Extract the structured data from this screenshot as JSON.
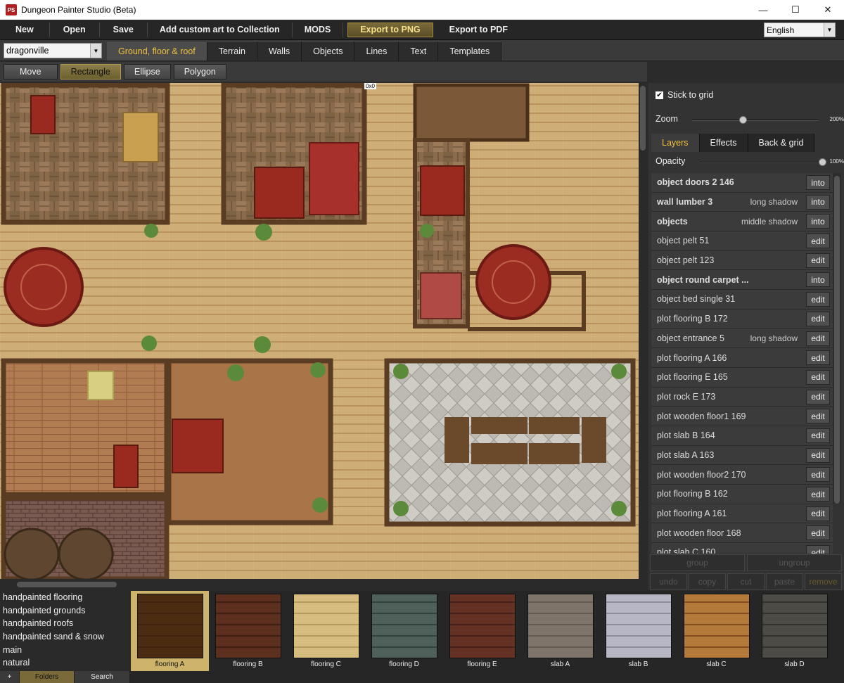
{
  "window": {
    "title": "Dungeon Painter Studio (Beta)",
    "logo_text": "PS",
    "minimize": "—",
    "maximize": "☐",
    "close": "✕"
  },
  "menu": {
    "items": [
      "New",
      "Open",
      "Save",
      "Add custom art to Collection",
      "MODS",
      "Export to PNG",
      "Export to PDF"
    ],
    "language": "English"
  },
  "map_selector": {
    "value": "dragonville"
  },
  "category_tabs": [
    "Ground, floor & roof",
    "Terrain",
    "Walls",
    "Objects",
    "Lines",
    "Text",
    "Templates"
  ],
  "shape_tools": [
    "Move",
    "Rectangle",
    "Ellipse",
    "Polygon"
  ],
  "canvas": {
    "size_readout": "0x0"
  },
  "right_panel": {
    "stick_to_grid": "Stick to grid",
    "zoom_label": "Zoom",
    "zoom_value": "200%",
    "zoom_level": 0.4,
    "tabs": [
      "Layers",
      "Effects",
      "Back & grid"
    ],
    "opacity_label": "Opacity",
    "opacity_value": "100%",
    "opacity_level": 1.0,
    "layers": [
      {
        "name": "object doors 2 146",
        "group": true,
        "shadow": "",
        "action": "into"
      },
      {
        "name": "wall lumber 3",
        "group": true,
        "shadow": "long shadow",
        "action": "into"
      },
      {
        "name": "objects",
        "group": true,
        "shadow": "middle shadow",
        "action": "into"
      },
      {
        "name": "object pelt 51",
        "group": false,
        "shadow": "",
        "action": "edit"
      },
      {
        "name": "object pelt 123",
        "group": false,
        "shadow": "",
        "action": "edit"
      },
      {
        "name": "object round carpet ...",
        "group": true,
        "shadow": "",
        "action": "into"
      },
      {
        "name": "object bed single 31",
        "group": false,
        "shadow": "",
        "action": "edit"
      },
      {
        "name": "plot flooring B 172",
        "group": false,
        "shadow": "",
        "action": "edit"
      },
      {
        "name": "object entrance 5",
        "group": false,
        "shadow": "long shadow",
        "action": "edit"
      },
      {
        "name": "plot flooring A 166",
        "group": false,
        "shadow": "",
        "action": "edit"
      },
      {
        "name": "plot flooring E 165",
        "group": false,
        "shadow": "",
        "action": "edit"
      },
      {
        "name": "plot rock E 173",
        "group": false,
        "shadow": "",
        "action": "edit"
      },
      {
        "name": "plot wooden floor1 169",
        "group": false,
        "shadow": "",
        "action": "edit"
      },
      {
        "name": "plot slab B 164",
        "group": false,
        "shadow": "",
        "action": "edit"
      },
      {
        "name": "plot slab A 163",
        "group": false,
        "shadow": "",
        "action": "edit"
      },
      {
        "name": "plot wooden floor2 170",
        "group": false,
        "shadow": "",
        "action": "edit"
      },
      {
        "name": "plot flooring B 162",
        "group": false,
        "shadow": "",
        "action": "edit"
      },
      {
        "name": "plot flooring A 161",
        "group": false,
        "shadow": "",
        "action": "edit"
      },
      {
        "name": "plot wooden floor 168",
        "group": false,
        "shadow": "",
        "action": "edit"
      },
      {
        "name": "plot slab C 160",
        "group": false,
        "shadow": "",
        "action": "edit"
      }
    ],
    "buttons": {
      "group": "group",
      "ungroup": "ungroup",
      "undo": "undo",
      "copy": "copy",
      "cut": "cut",
      "paste": "paste",
      "remove": "remove"
    }
  },
  "folders": {
    "items": [
      "handpainted flooring",
      "handpainted grounds",
      "handpainted roofs",
      "handpainted sand & snow",
      "main",
      "natural"
    ],
    "add_label": "+",
    "folders_label": "Folders",
    "search_label": "Search"
  },
  "textures": [
    {
      "label": "flooring A",
      "selected": true,
      "c1": "#8a6a46",
      "c2": "#6e5236"
    },
    {
      "label": "flooring B",
      "selected": false,
      "c1": "#9a6e58",
      "c2": "#6a4838"
    },
    {
      "label": "flooring C",
      "selected": false,
      "c1": "#eadbb4",
      "c2": "#c8b48a"
    },
    {
      "label": "flooring D",
      "selected": false,
      "c1": "#8e9c98",
      "c2": "#5e6c6a"
    },
    {
      "label": "flooring E",
      "selected": false,
      "c1": "#a07060",
      "c2": "#6e4a40"
    },
    {
      "label": "slab A",
      "selected": false,
      "c1": "#b4aca4",
      "c2": "#8e8680"
    },
    {
      "label": "slab B",
      "selected": false,
      "c1": "#d8d8e0",
      "c2": "#a8a8b4"
    },
    {
      "label": "slab C",
      "selected": false,
      "c1": "#d6b07a",
      "c2": "#9c7040"
    },
    {
      "label": "slab D",
      "selected": false,
      "c1": "#8c8a86",
      "c2": "#5e5c58"
    }
  ]
}
